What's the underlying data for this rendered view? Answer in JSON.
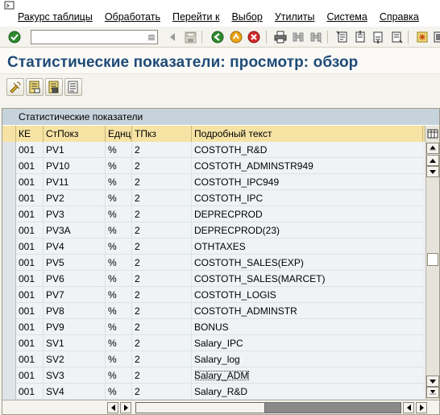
{
  "menu": {
    "items": [
      {
        "label": "Ракурс таблицы"
      },
      {
        "label": "Обработать"
      },
      {
        "label": "Перейти к"
      },
      {
        "label": "Выбор"
      },
      {
        "label": "Утилиты"
      },
      {
        "label": "Система"
      },
      {
        "label": "Справка"
      }
    ]
  },
  "toolbar": {
    "command_value": "",
    "icons": [
      "enter-checkmark-icon",
      "save-icon",
      "back-icon",
      "exit-icon",
      "cancel-icon",
      "print-icon",
      "find-icon",
      "find-next-icon",
      "first-page-icon",
      "previous-page-icon",
      "next-page-icon",
      "last-page-icon",
      "create-session-icon",
      "layout-icon"
    ]
  },
  "title": "Статистические показатели: просмотр: обзор",
  "app_toolbar": {
    "icons": [
      "change-display-toggle-icon",
      "details-icon",
      "copy-as-icon",
      "delete-icon"
    ]
  },
  "table": {
    "caption": "Статистические показатели",
    "columns": [
      "КЕ",
      "СтПокз",
      "Еднц",
      "ТПкз",
      "Подробный текст"
    ],
    "rows": [
      [
        "001",
        "PV1",
        "%",
        "2",
        "COSTOTH_R&D"
      ],
      [
        "001",
        "PV10",
        "%",
        "2",
        "COSTOTH_ADMINSTR949"
      ],
      [
        "001",
        "PV11",
        "%",
        "2",
        "COSTOTH_IPC949"
      ],
      [
        "001",
        "PV2",
        "%",
        "2",
        "COSTOTH_IPC"
      ],
      [
        "001",
        "PV3",
        "%",
        "2",
        "DEPRECPROD"
      ],
      [
        "001",
        "PV3A",
        "%",
        "2",
        "DEPRECPROD(23)"
      ],
      [
        "001",
        "PV4",
        "%",
        "2",
        "OTHTAXES"
      ],
      [
        "001",
        "PV5",
        "%",
        "2",
        "COSTOTH_SALES(EXP)"
      ],
      [
        "001",
        "PV6",
        "%",
        "2",
        "COSTOTH_SALES(MARCET)"
      ],
      [
        "001",
        "PV7",
        "%",
        "2",
        "COSTOTH_LOGIS"
      ],
      [
        "001",
        "PV8",
        "%",
        "2",
        "COSTOTH_ADMINSTR"
      ],
      [
        "001",
        "PV9",
        "%",
        "2",
        "BONUS"
      ],
      [
        "001",
        "SV1",
        "%",
        "2",
        "Salary_IPC"
      ],
      [
        "001",
        "SV2",
        "%",
        "2",
        "Salary_log"
      ],
      [
        "001",
        "SV3",
        "%",
        "2",
        "Salary_ADM"
      ],
      [
        "001",
        "SV4",
        "%",
        "2",
        "Salary_R&D"
      ]
    ]
  },
  "colors": {
    "title": "#1f4b78",
    "header_bg": "#f6e3a4",
    "caption_bg": "#c7d3dc",
    "row_bg": "#eff3f6"
  }
}
